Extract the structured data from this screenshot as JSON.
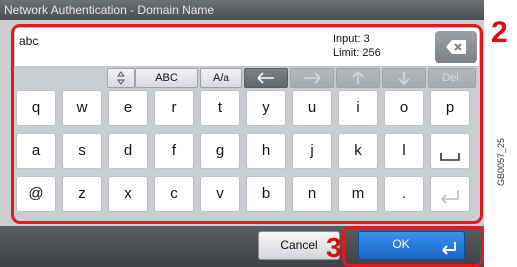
{
  "title": "Network Authentication - Domain Name",
  "input": {
    "value": "abc",
    "count_label": "Input:",
    "count": "3",
    "limit_label": "Limit:",
    "limit": "256"
  },
  "controls": {
    "abc": "ABC",
    "case_big": "A",
    "case_sep": "/",
    "case_small": "a",
    "delete": "Del."
  },
  "rows": [
    [
      "q",
      "w",
      "e",
      "r",
      "t",
      "y",
      "u",
      "i",
      "o",
      "p"
    ],
    [
      "a",
      "s",
      "d",
      "f",
      "g",
      "h",
      "j",
      "k",
      "l"
    ],
    [
      "@",
      "z",
      "x",
      "c",
      "v",
      "b",
      "n",
      "m",
      "."
    ]
  ],
  "buttons": {
    "cancel": "Cancel",
    "ok": "OK"
  },
  "callouts": {
    "step2": "2",
    "step3": "3"
  },
  "figure_code": "GB0057_25",
  "colors": {
    "highlight": "#e11a1a",
    "ok_blue": "#1f74d6"
  }
}
